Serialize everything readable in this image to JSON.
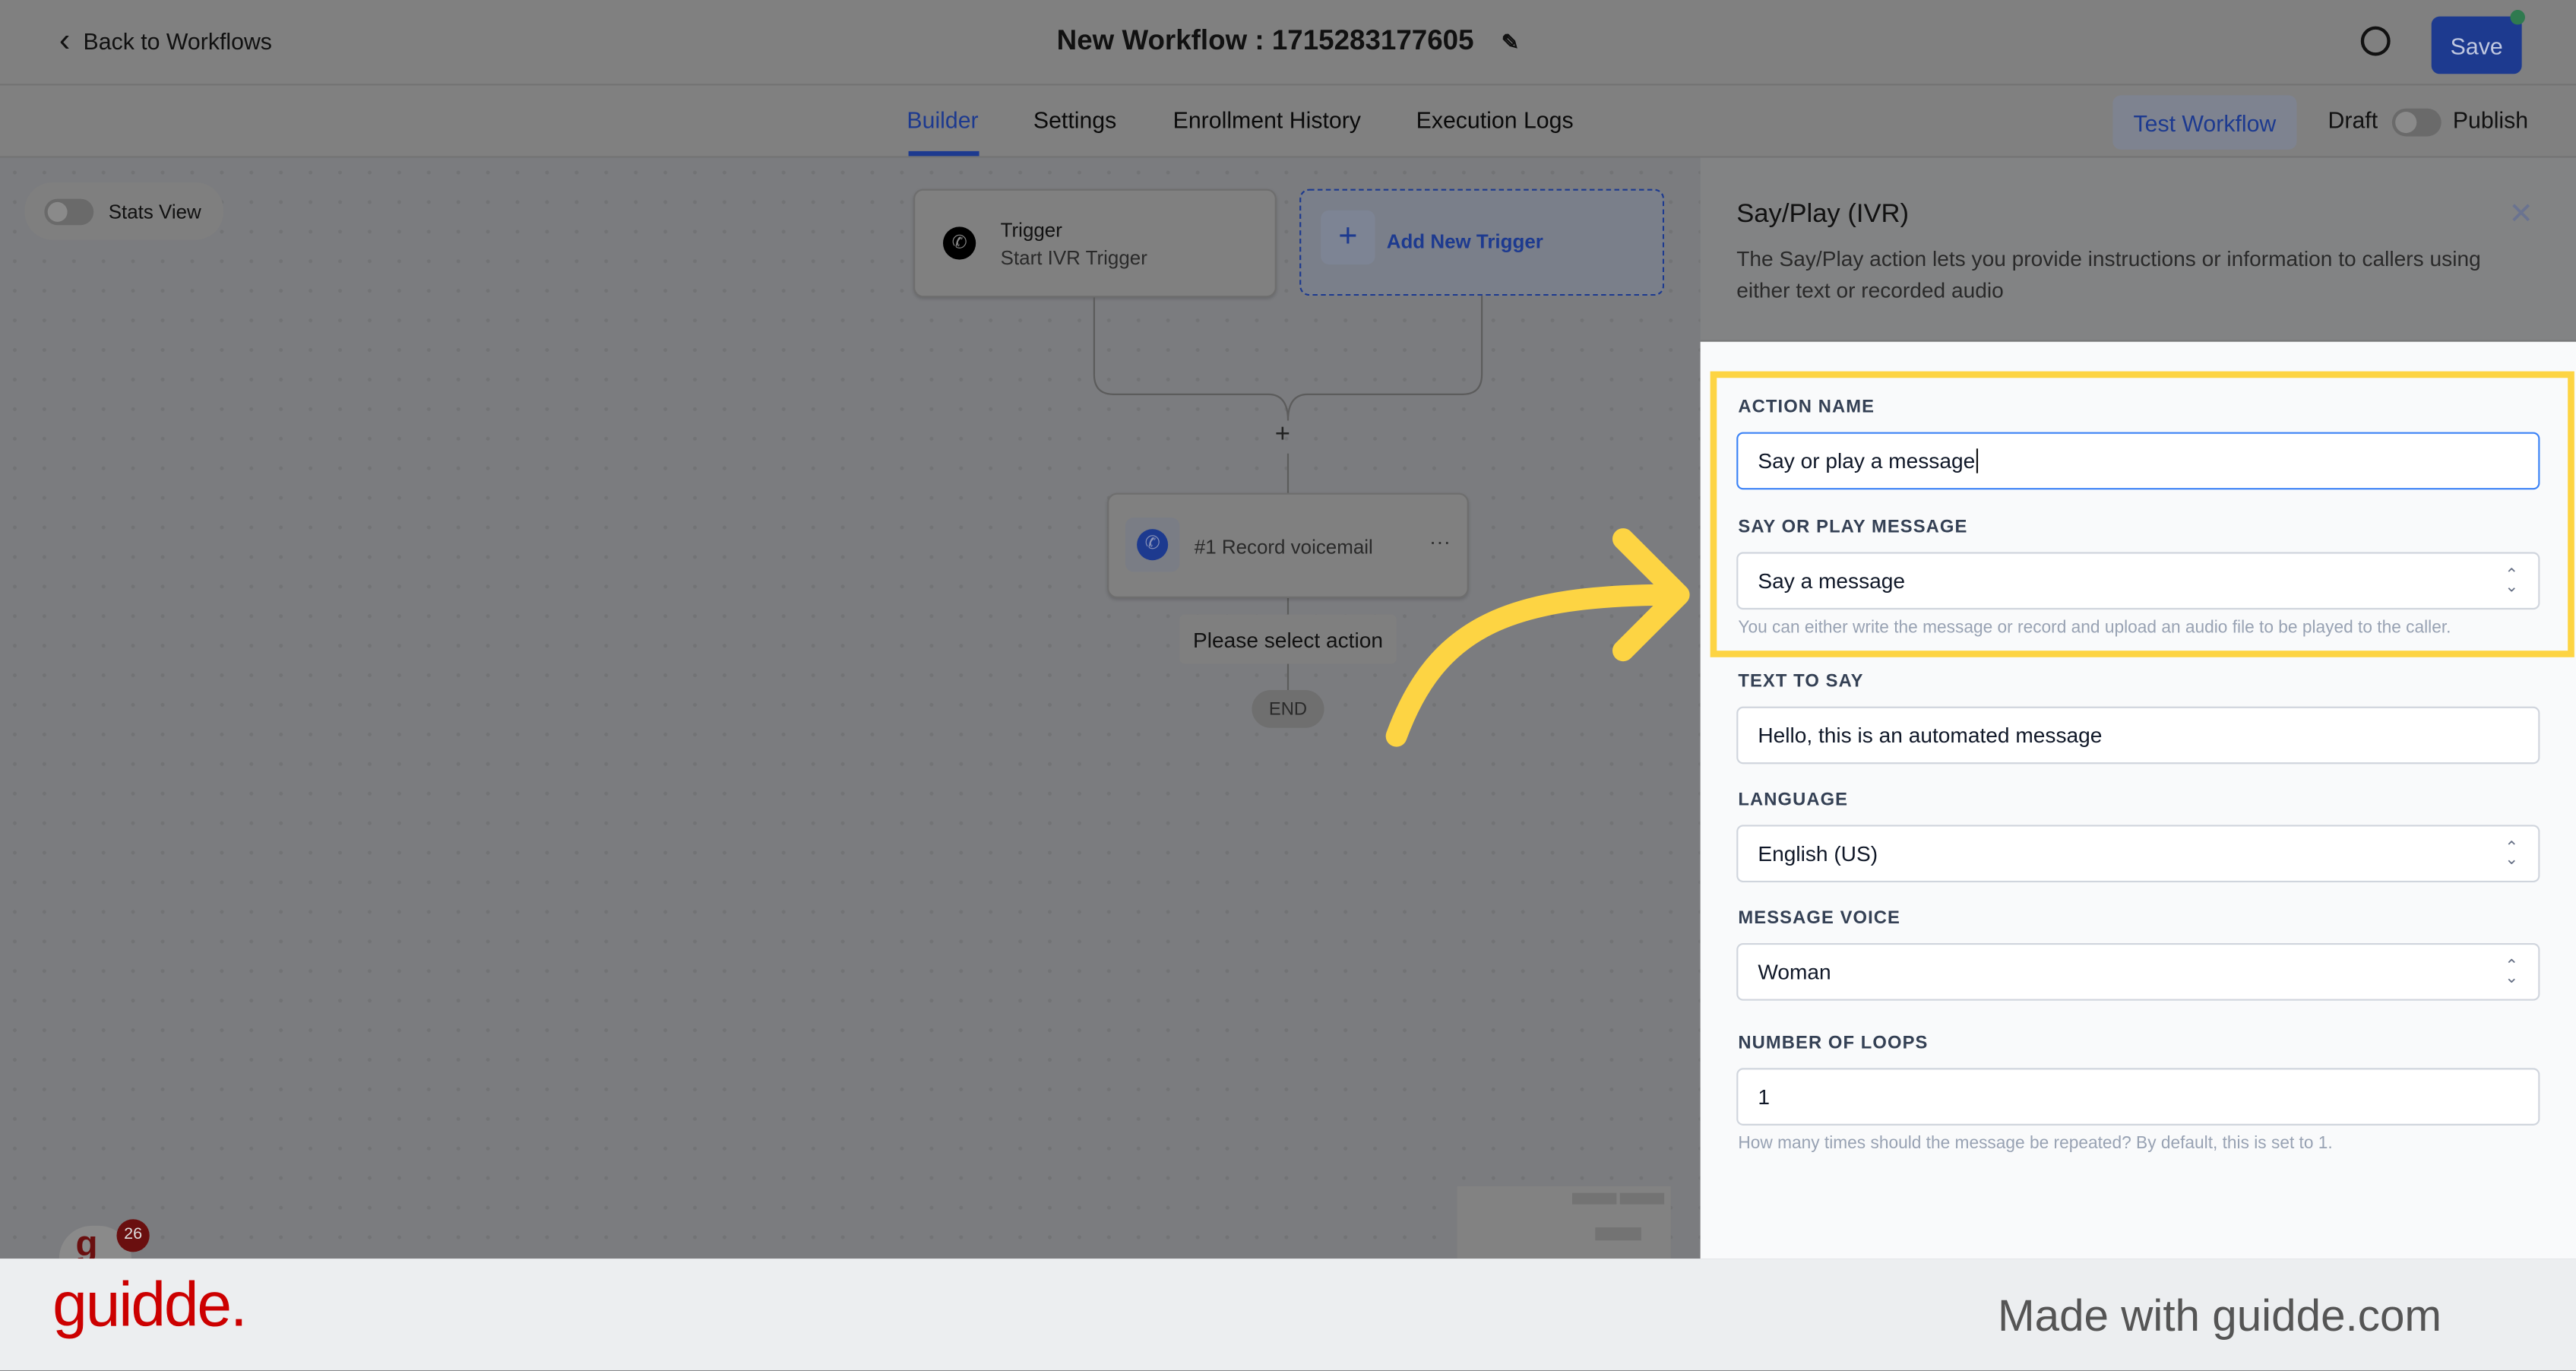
{
  "header": {
    "back_label": "Back to Workflows",
    "title": "New Workflow : 1715283177605",
    "save_label": "Save"
  },
  "tabs": [
    {
      "label": "Builder",
      "active": true
    },
    {
      "label": "Settings"
    },
    {
      "label": "Enrollment History"
    },
    {
      "label": "Execution Logs"
    }
  ],
  "actions": {
    "test_label": "Test Workflow",
    "draft_label": "Draft",
    "publish_label": "Publish",
    "published": false
  },
  "canvas": {
    "stats_view_label": "Stats View",
    "stats_view_on": false,
    "trigger": {
      "title": "Trigger",
      "subtitle": "Start IVR Trigger"
    },
    "add_trigger_label": "Add New Trigger",
    "action_node": {
      "label": "#1 Record voicemail"
    },
    "placeholder_label": "Please select action",
    "end_label": "END",
    "notification_count": "26"
  },
  "panel": {
    "title": "Say/Play (IVR)",
    "description": "The Say/Play action lets you provide instructions or information to callers using either text or recorded audio",
    "fields": [
      {
        "label": "ACTION NAME",
        "value": "Say or play a message"
      },
      {
        "label": "SAY OR PLAY MESSAGE",
        "value": "Say a message",
        "hint": "You can either write the message or record and upload an audio file to be played to the caller."
      },
      {
        "label": "TEXT TO SAY",
        "value": "Hello, this is an automated message"
      },
      {
        "label": "LANGUAGE",
        "value": "English (US)"
      },
      {
        "label": "MESSAGE VOICE",
        "value": "Woman"
      },
      {
        "label": "NUMBER OF LOOPS",
        "value": "1",
        "hint": "How many times should the message be repeated? By default, this is set to 1."
      }
    ]
  },
  "footer": {
    "logo": "guidde.",
    "tagline": "Made with guidde.com"
  },
  "colors": {
    "accent": "#1d3a8f",
    "highlight": "#fdd443",
    "brand": "#cc0000"
  }
}
